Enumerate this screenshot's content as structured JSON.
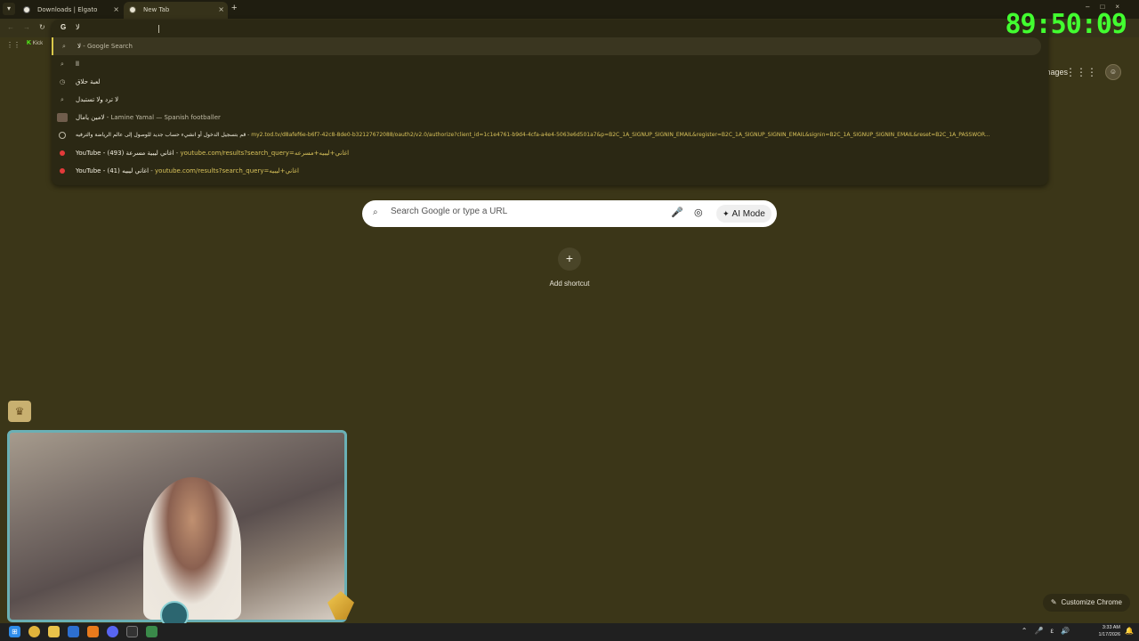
{
  "tabs": [
    {
      "title": "Downloads | Elgato",
      "close": "×"
    },
    {
      "title": "New Tab",
      "close": "×"
    }
  ],
  "new_tab_glyph": "+",
  "window_controls": "–□×",
  "toolbar": {
    "back": "←",
    "forward": "→",
    "reload": "↻"
  },
  "omnibox": {
    "g_icon": "G",
    "text": "لا",
    "suggestions": [
      {
        "icon": "search",
        "main": "لا",
        "sub": " - Google Search",
        "url": ""
      },
      {
        "icon": "search",
        "main": "lا",
        "sub": "",
        "url": ""
      },
      {
        "icon": "history",
        "main": "لعبة حلاق",
        "sub": "",
        "url": ""
      },
      {
        "icon": "search",
        "main": "لا ترد ولا تستبدل",
        "sub": "",
        "url": ""
      },
      {
        "icon": "thumb",
        "main": "لامين يامال",
        "sub": " - Lamine Yamal — Spanish footballer",
        "url": ""
      },
      {
        "icon": "globe",
        "main": "قم بتسجيل الدخول أو انشيء حساب جديد للوصول إلى عالم الرياضة والترفيه",
        "sub": " - ",
        "url": "my2.tod.tv/d8afef6e-b6f7-42c8-8de0-b32127672088/oauth2/v2.0/authorize?client_id=1c1e4761-b9d4-4cfa-a4e4-5063e6d501a7&p=B2C_1A_SIGNUP_SIGNIN_EMAIL&register=B2C_1A_SIGNUP_SIGNIN_EMAIL&signin=B2C_1A_SIGNUP_SIGNIN_EMAIL&reset=B2C_1A_PASSWOR..."
      },
      {
        "icon": "youtube",
        "main": "YouTube - اغاني ليبية مسرعة (493)",
        "sub": " - ",
        "url": "youtube.com/results?search_query=اغاني+ليبيه+مسرعه"
      },
      {
        "icon": "youtube",
        "main": "YouTube - اغاني ليبيه (41)",
        "sub": " - ",
        "url": "youtube.com/results?search_query=اغاني+ليبيه"
      }
    ]
  },
  "bookmarks": {
    "apps": "⋮⋮",
    "kick_logo": "K",
    "kick_label": "Kick"
  },
  "header": {
    "images": "Images",
    "apps_grid": "⋮⋮⋮",
    "profile": "☺"
  },
  "search": {
    "icon": "⌕",
    "placeholder": "Search Google or type a URL",
    "mic": "🎤",
    "lens": "◎",
    "ai_icon": "✦",
    "ai_mode": "AI Mode"
  },
  "shortcut": {
    "plus": "+",
    "label": "Add shortcut"
  },
  "stream": {
    "timer": "89:50:09",
    "crown": "♛"
  },
  "customize": {
    "icon": "✎",
    "label": "Customize Chrome"
  },
  "taskbar": {
    "start": "⊞",
    "tray": "⌃🎤ε🔊",
    "time": "3:33 AM",
    "date": "1/17/2026",
    "notifications": "🔔"
  }
}
